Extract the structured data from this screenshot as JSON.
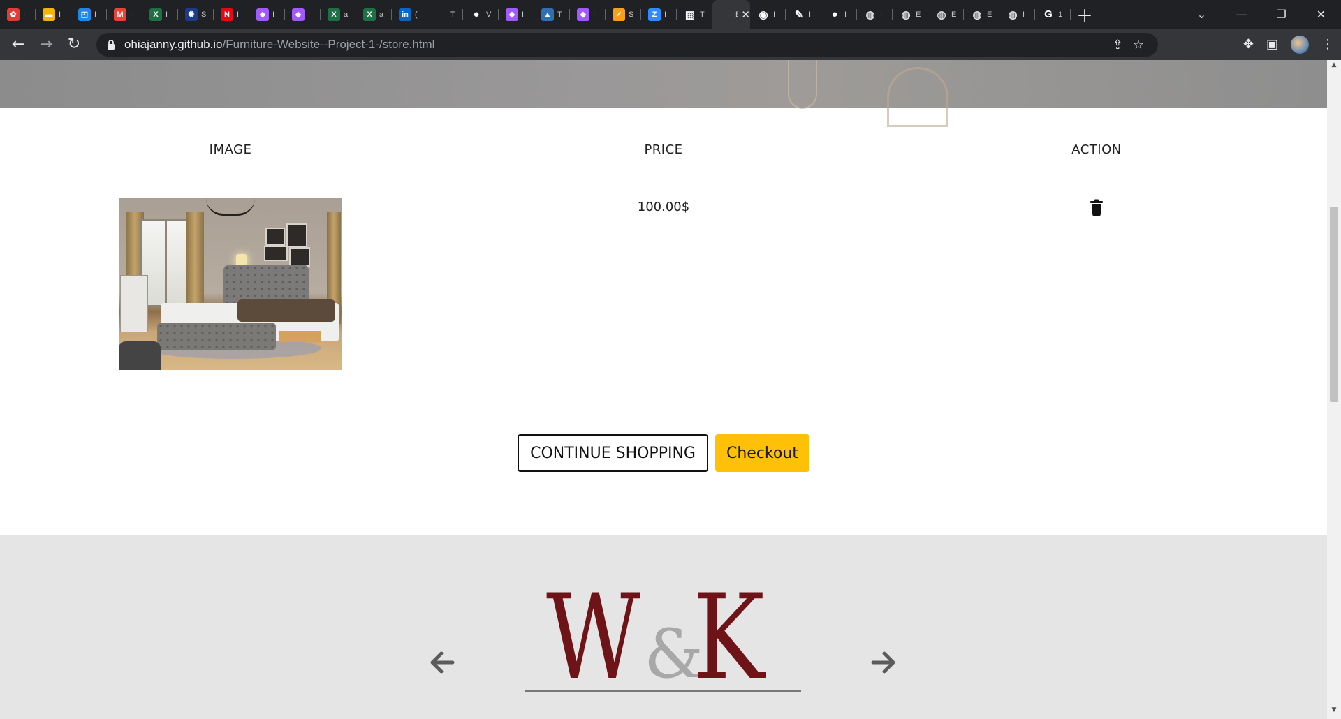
{
  "browser": {
    "tabs": [
      {
        "icon": "flower-icon",
        "color": "#e53935",
        "glyph": "✿",
        "title": "I"
      },
      {
        "icon": "slides-icon",
        "color": "#f4b400",
        "glyph": "▬",
        "title": "I"
      },
      {
        "icon": "azure-icon",
        "color": "#1e88e5",
        "glyph": "◰",
        "title": "I"
      },
      {
        "icon": "gmail-icon",
        "color": "#ea4335",
        "glyph": "M",
        "title": "I"
      },
      {
        "icon": "excel-icon",
        "color": "#1e7145",
        "glyph": "X",
        "title": "I"
      },
      {
        "icon": "eu-icon",
        "color": "#1a3c8a",
        "glyph": "✺",
        "title": "S"
      },
      {
        "icon": "netflix-icon",
        "color": "#e50914",
        "glyph": "N",
        "title": "I"
      },
      {
        "icon": "figma-icon",
        "color": "#a259ff",
        "glyph": "◆",
        "title": "I"
      },
      {
        "icon": "figma-icon",
        "color": "#a259ff",
        "glyph": "◆",
        "title": "I"
      },
      {
        "icon": "excel-icon",
        "color": "#1e7145",
        "glyph": "X",
        "title": "a"
      },
      {
        "icon": "excel-icon",
        "color": "#1e7145",
        "glyph": "X",
        "title": "a"
      },
      {
        "icon": "linkedin-icon",
        "color": "#0a66c2",
        "glyph": "in",
        "title": "("
      },
      {
        "icon": "blank-icon",
        "color": "#202124",
        "glyph": "",
        "title": "T"
      },
      {
        "icon": "github-icon",
        "color": "#ffffff",
        "glyph": "●",
        "title": "V"
      },
      {
        "icon": "figma-icon",
        "color": "#a259ff",
        "glyph": "◆",
        "title": "I"
      },
      {
        "icon": "mountain-icon",
        "color": "#2f6fb3",
        "glyph": "▲",
        "title": "T"
      },
      {
        "icon": "figma-icon",
        "color": "#a259ff",
        "glyph": "◆",
        "title": "I"
      },
      {
        "icon": "check-circle-icon",
        "color": "#f7a01c",
        "glyph": "✓",
        "title": "S"
      },
      {
        "icon": "zoom-icon",
        "color": "#2d8cff",
        "glyph": "Z",
        "title": "I"
      },
      {
        "icon": "image-icon",
        "color": "#f5f5f5",
        "glyph": "▧",
        "title": "T"
      },
      {
        "icon": "blank-icon",
        "color": "#35363a",
        "glyph": "",
        "title": "B",
        "active": true
      },
      {
        "icon": "chrome-icon",
        "color": "#ffffff",
        "glyph": "◉",
        "title": "I"
      },
      {
        "icon": "pen-icon",
        "color": "#ffffff",
        "glyph": "✎",
        "title": "I"
      },
      {
        "icon": "github-icon",
        "color": "#ffffff",
        "glyph": "●",
        "title": "I"
      },
      {
        "icon": "globe-icon",
        "color": "#dadce0",
        "glyph": "◍",
        "title": "I"
      },
      {
        "icon": "globe-icon",
        "color": "#dadce0",
        "glyph": "◍",
        "title": "E"
      },
      {
        "icon": "globe-icon",
        "color": "#dadce0",
        "glyph": "◍",
        "title": "E"
      },
      {
        "icon": "globe-icon",
        "color": "#dadce0",
        "glyph": "◍",
        "title": "E"
      },
      {
        "icon": "globe-icon",
        "color": "#dadce0",
        "glyph": "◍",
        "title": "I"
      },
      {
        "icon": "google-icon",
        "color": "#ffffff",
        "glyph": "G",
        "title": "1"
      }
    ],
    "url_host": "ohiajanny.github.io",
    "url_path": "/Furniture-Website--Project-1-/store.html"
  },
  "cart": {
    "headers": {
      "image": "IMAGE",
      "price": "PRICE",
      "action": "ACTION"
    },
    "items": [
      {
        "price": "100.00$"
      }
    ]
  },
  "buttons": {
    "continue": "CONTINUE SHOPPING",
    "checkout": "Checkout"
  },
  "logo": {
    "w": "W",
    "amp": "&",
    "k": "K"
  },
  "colors": {
    "accent": "#ffc107",
    "logo": "#6e1418",
    "footer_bg": "#e5e5e5"
  }
}
